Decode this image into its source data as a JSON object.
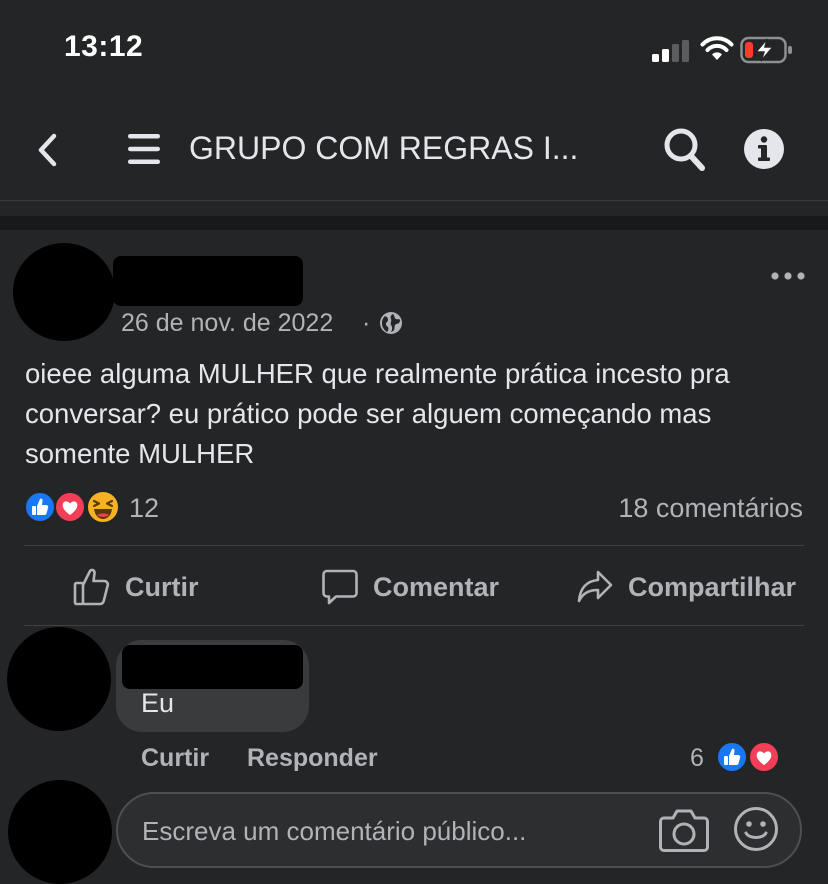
{
  "status_bar": {
    "time": "13:12"
  },
  "nav": {
    "back_icon": "chevron-left-icon",
    "menu_icon": "hamburger-menu-icon",
    "title": "GRUPO COM REGRAS I...",
    "search_icon": "search-icon",
    "info_icon": "info-icon"
  },
  "post": {
    "date": "26 de nov. de 2022",
    "separator": "·",
    "privacy_icon": "globe-icon",
    "text": "oieee alguma MULHER que realmente prática incesto pra conversar? eu prático pode ser alguem começando mas somente MULHER",
    "reactions": [
      "like",
      "love",
      "haha"
    ],
    "reaction_count": "12",
    "comments_count": "18 comentários"
  },
  "actions": {
    "like": "Curtir",
    "comment": "Comentar",
    "share": "Compartilhar"
  },
  "comment": {
    "text": "Eu",
    "like_label": "Curtir",
    "reply_label": "Responder",
    "reaction_count": "6",
    "reactions": [
      "like",
      "love"
    ]
  },
  "composer": {
    "placeholder": "Escreva um comentário público...",
    "camera_icon": "camera-icon",
    "emoji_icon": "emoji-icon"
  },
  "colors": {
    "background": "#242526",
    "text_primary": "#e4e6eb",
    "text_secondary": "#b0b3b8",
    "like_blue": "#1877f2",
    "love_red": "#f33e58",
    "haha_yellow": "#f7b125",
    "battery_low": "#ff3b30"
  }
}
